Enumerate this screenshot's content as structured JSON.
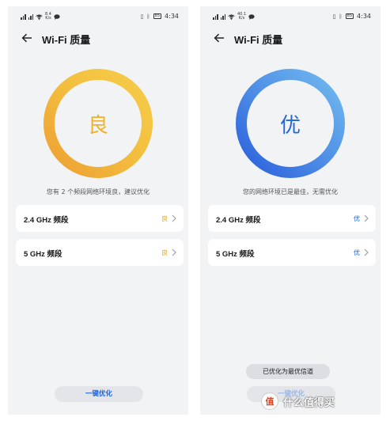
{
  "screens": [
    {
      "statusbar": {
        "speed": "8.4\nK/s",
        "time": "4:34",
        "battery": "85"
      },
      "title": "Wi-Fi 质量",
      "grade": "良",
      "grade_color": "#f0b22e",
      "ring_colors": [
        "#f4c542",
        "#eea236"
      ],
      "hint": "您有 2 个频段网络环境良，建议优化",
      "bands": [
        {
          "label": "2.4 GHz 频段",
          "status": "良"
        },
        {
          "label": "5 GHz 频段",
          "status": "良"
        }
      ],
      "status_color": "#e6a416",
      "button": "一键优化"
    },
    {
      "statusbar": {
        "speed": "40.1\nK/s",
        "time": "4:34",
        "battery": "85"
      },
      "title": "Wi-Fi 质量",
      "grade": "优",
      "grade_color": "#2266d9",
      "ring_colors": [
        "#66b2ec",
        "#2a63dd"
      ],
      "hint": "您的网络环境已是最佳，无需优化",
      "bands": [
        {
          "label": "2.4 GHz 频段",
          "status": "优"
        },
        {
          "label": "5 GHz 频段",
          "status": "优"
        }
      ],
      "status_color": "#2266d9",
      "toast": "已优化为最优信道",
      "button": "一键优化"
    }
  ],
  "watermark": {
    "badge": "值",
    "text": "什么值得买"
  }
}
